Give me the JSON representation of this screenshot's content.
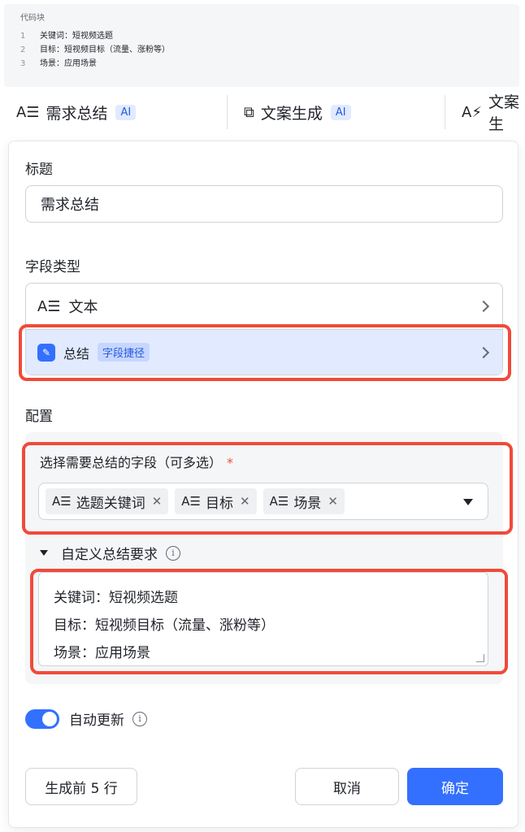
{
  "code_block": {
    "title": "代码块",
    "lines": [
      {
        "num": "1",
        "text": "关键词：短视频选题"
      },
      {
        "num": "2",
        "text": "目标：短视频目标（流量、涨粉等）"
      },
      {
        "num": "3",
        "text": "场景：应用场景"
      }
    ]
  },
  "tabs": [
    {
      "icon": "A☰",
      "label": "需求总结",
      "badge": "AI"
    },
    {
      "icon": "⧉",
      "label": "文案生成",
      "badge": "AI"
    },
    {
      "icon": "A⚡",
      "label": "文案生"
    }
  ],
  "form": {
    "title_label": "标题",
    "title_value": "需求总结",
    "field_type_label": "字段类型",
    "field_type_value": "文本",
    "summary_label": "总结",
    "summary_badge": "字段捷径",
    "config_label": "配置",
    "select_fields_label": "选择需要总结的字段（可多选）",
    "required_mark": "*",
    "tags": [
      "选题关键词",
      "目标",
      "场景"
    ],
    "custom_label": "自定义总结要求",
    "custom_lines": [
      "关键词：短视频选题",
      "目标：短视频目标（流量、涨粉等）",
      "场景：应用场景"
    ],
    "auto_update_label": "自动更新"
  },
  "buttons": {
    "generate": "生成前 5 行",
    "cancel": "取消",
    "confirm": "确定"
  },
  "colors": {
    "accent": "#3370ff",
    "highlight": "#e1eaff",
    "red_outline": "#f04a3a"
  }
}
